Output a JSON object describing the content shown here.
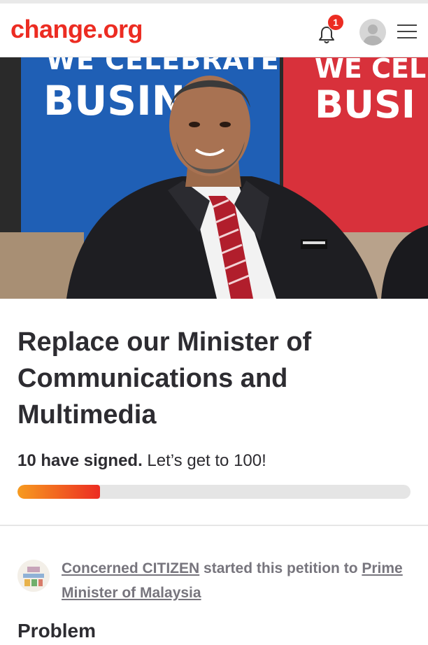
{
  "header": {
    "logo": "change.org",
    "notification_count": "1",
    "brand_color": "#ec2c22"
  },
  "hero": {
    "banner_text_top": "WE CELEBRATE",
    "banner_text_main": "BUSINE",
    "banner_text_top_right": "WE CEL",
    "banner_text_main_right": "BUSI"
  },
  "petition": {
    "title": "Replace our Minister of Communications and Multimedia",
    "signed_bold": "10 have signed.",
    "signed_goal": "Let’s get to 100!",
    "signature_count": 10,
    "signature_goal": 100,
    "progress_fraction": 0.21
  },
  "starter": {
    "name": "Concerned CITIZEN",
    "middle_text": "started this petition to",
    "target": "Prime Minister of Malaysia"
  },
  "next_section_heading": "Problem"
}
